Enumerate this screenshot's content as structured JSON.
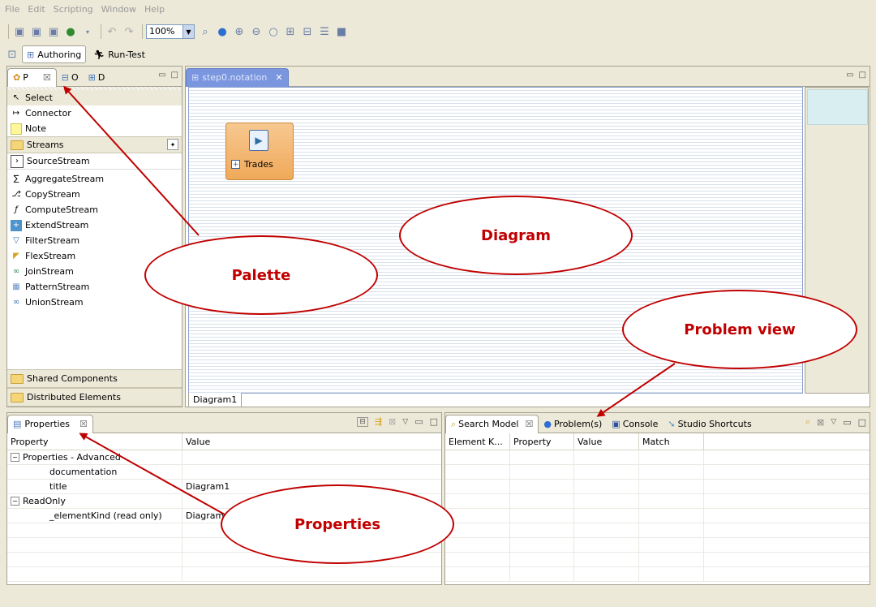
{
  "menu": [
    "File",
    "Edit",
    "Scripting",
    "Window",
    "Help"
  ],
  "toolbar": {
    "zoom": "100%"
  },
  "perspectives": {
    "authoring": "Authoring",
    "run_test": "Run-Test"
  },
  "palette": {
    "tabs": [
      "P",
      "O",
      "D"
    ],
    "tools": [
      {
        "label": "Select"
      },
      {
        "label": "Connector"
      },
      {
        "label": "Note"
      }
    ],
    "streams_drawer": "Streams",
    "streams": [
      "SourceStream",
      "AggregateStream",
      "CopyStream",
      "ComputeStream",
      "ExtendStream",
      "FilterStream",
      "FlexStream",
      "JoinStream",
      "PatternStream",
      "UnionStream"
    ],
    "drawers": [
      "Shared Components",
      "Distributed Elements"
    ]
  },
  "editor": {
    "tab": "step0.notation",
    "node_label": "Trades",
    "page_tab": "Diagram1"
  },
  "properties": {
    "tab": "Properties",
    "columns": [
      "Property",
      "Value"
    ],
    "rows": [
      {
        "name": "Properties - Advanced",
        "value": "",
        "indent": 0,
        "group": true
      },
      {
        "name": "documentation",
        "value": "",
        "indent": 1,
        "group": false
      },
      {
        "name": "title",
        "value": "Diagram1",
        "indent": 1,
        "group": false
      },
      {
        "name": "ReadOnly",
        "value": "",
        "indent": 0,
        "group": true
      },
      {
        "name": "_elementKind (read only)",
        "value": "Diagram",
        "indent": 1,
        "group": false
      }
    ]
  },
  "bottom_right": {
    "tabs": [
      "Search Model",
      "Problem(s)",
      "Console",
      "Studio Shortcuts"
    ],
    "columns": [
      "Element K...",
      "Property",
      "Value",
      "Match"
    ]
  },
  "callouts": {
    "palette": "Palette",
    "diagram": "Diagram",
    "problem_view": "Problem view",
    "properties": "Properties"
  },
  "colors": {
    "callout": "#c00000",
    "chrome": "#ece9d8",
    "selection": "#d8eef0"
  }
}
